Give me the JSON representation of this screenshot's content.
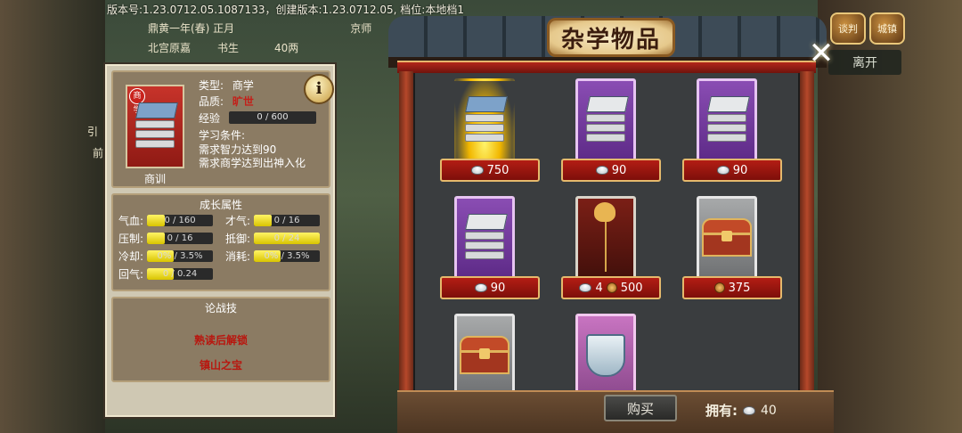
{
  "version_text": "版本号:1.23.0712.05.1087133，创建版本:1.23.0712.05, 档位:本地档1",
  "background": {
    "rows": [
      "鼎黄一年(春) 正月",
      "北宫原嘉",
      "书生",
      "40两",
      "京师"
    ],
    "leave_label": "离开",
    "side_buttons": [
      "谈判",
      "城镇"
    ],
    "left_fragments": [
      "引",
      "前"
    ]
  },
  "shop": {
    "title": "杂学物品",
    "close_symbol": "✕",
    "items": [
      {
        "icon": "book-icon",
        "rarity": "gold",
        "price_silver": "750"
      },
      {
        "icon": "book-icon",
        "rarity": "purple",
        "price_silver": "90"
      },
      {
        "icon": "book-icon",
        "rarity": "purple",
        "price_silver": "90"
      },
      {
        "icon": "book-icon",
        "rarity": "purple",
        "price_silver": "90"
      },
      {
        "icon": "phoenix-hairpin-icon",
        "rarity": "red",
        "price_silver": "4",
        "price_gold": "500"
      },
      {
        "icon": "treasure-chest-icon",
        "rarity": "grey",
        "price_gold": "375"
      },
      {
        "icon": "treasure-chest-icon",
        "rarity": "grey",
        "price_silver": ""
      },
      {
        "icon": "cup-icon",
        "rarity": "pink",
        "price_silver": ""
      }
    ],
    "buy_label": "购买",
    "owned_label": "拥有:",
    "owned_value": "40"
  },
  "info": {
    "type_label": "类型:",
    "type_value": "商学",
    "quality_label": "品质:",
    "quality_value": "旷世",
    "exp_label": "经验",
    "exp_value": "0 / 600",
    "req_label": "学习条件:",
    "req_lines": [
      "需求智力达到90",
      "需求商学达到出神入化"
    ],
    "item_name": "商训",
    "thumb_tag": "商学",
    "info_symbol": "i",
    "growth_title": "成长属性",
    "stats": [
      {
        "label": "气血:",
        "value": "0 / 160"
      },
      {
        "label": "才气:",
        "value": "0 / 16"
      },
      {
        "label": "压制:",
        "value": "0 / 16"
      },
      {
        "label": "抵御:",
        "value": "0 / 24"
      },
      {
        "label": "冷却:",
        "value": "0% / 3.5%"
      },
      {
        "label": "消耗:",
        "value": "0% / 3.5%"
      },
      {
        "label": "回气:",
        "value": "0 / 0.24"
      }
    ],
    "skills_title": "论战技",
    "skills": [
      "熟读后解锁",
      "镇山之宝"
    ]
  }
}
